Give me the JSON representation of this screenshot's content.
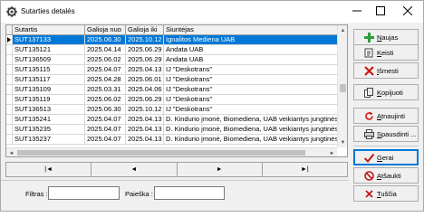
{
  "window": {
    "title": "Sutarties detalės"
  },
  "grid": {
    "columns": [
      "Sutartis",
      "Galioja nuo",
      "Galioja iki",
      "Siuntėjas"
    ],
    "rows": [
      [
        "SUT137133",
        "2025.06.30",
        "2025.10.12",
        "Ignalitos Medienа UAB"
      ],
      [
        "SUT135121",
        "2025.04.14",
        "2025.06.29",
        "Andata UAB"
      ],
      [
        "SUT136509",
        "2025.06.02",
        "2025.06.29",
        "Andata UAB"
      ],
      [
        "SUT135115",
        "2025.04.07",
        "2025.04.13",
        "IJ \"Deskotrans\""
      ],
      [
        "SUT135117",
        "2025.04.28",
        "2025.06.01",
        "IJ \"Deskotrans\""
      ],
      [
        "SUT135109",
        "2025.03.31",
        "2025.04.06",
        "IJ \"Deskotrans\""
      ],
      [
        "SUT135119",
        "2025.06.02",
        "2025.06.29",
        "IJ \"Deskotrans\""
      ],
      [
        "SUT136513",
        "2025.06.30",
        "2025.10.12",
        "IJ \"Deskotrans\""
      ],
      [
        "SUT135241",
        "2025.04.07",
        "2025.04.13",
        "D. Kindurio įmonė, Biomediena, UAB veikiantys jungtinės veik"
      ],
      [
        "SUT135235",
        "2025.04.07",
        "2025.04.13",
        "D. Kindurio įmonė, Biomediena, UAB veikiantys jungtinės veik"
      ],
      [
        "SUT135237",
        "2025.04.07",
        "2025.04.13",
        "D. Kindurio įmonė, Biomediena, UAB veikiantys jungtinės veik"
      ]
    ],
    "selected_row": 0
  },
  "nav": {
    "first": "|◄",
    "prev": "◄",
    "next": "►",
    "last": "►|"
  },
  "filters": {
    "filter_label": "Filtras :",
    "search_label": "Paieška :",
    "filter_value": "",
    "search_value": ""
  },
  "buttons": {
    "new_a": "N",
    "new_b": "aujas",
    "edit_a": "K",
    "edit_b": "eisti",
    "delete_a": "I",
    "delete_b": "šmesti",
    "copy_a": "K",
    "copy_b": "opijuoti",
    "refresh_a": "A",
    "refresh_b": "tnaujinti",
    "print_a": "S",
    "print_b": "pausdinti ...",
    "ok_a": "G",
    "ok_b": "erai",
    "cancel_a": "A",
    "cancel_b": "tšaukti",
    "clear_a": "T",
    "clear_b": "uščia"
  },
  "colors": {
    "selection": "#0078d7",
    "add_green": "#2e9e3a",
    "delete_red": "#d01818",
    "ok_red": "#c41818"
  }
}
